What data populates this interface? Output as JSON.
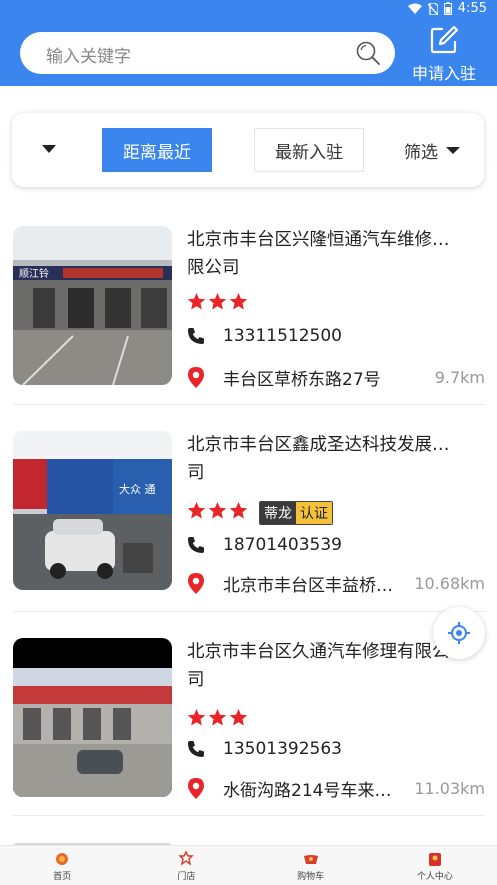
{
  "status_bar": {
    "time": "4:55"
  },
  "search": {
    "placeholder": "输入关键字"
  },
  "apply": {
    "label": "申请入驻"
  },
  "filters": {
    "nearest": "距离最近",
    "newest": "最新入驻",
    "filter": "筛选",
    "active": "nearest"
  },
  "shops": [
    {
      "name": "北京市丰台区兴隆恒通汽车维修…限公司",
      "name_line1": "北京市丰台区兴隆恒通汽车维修…",
      "name_line2": "限公司",
      "rating": 3,
      "phone": "13311512500",
      "address": "丰台区草桥东路27号",
      "distance": "9.7km",
      "sign_text": "顺江铃"
    },
    {
      "name_line1": "北京市丰台区鑫成圣达科技发展…",
      "name_line2": "司",
      "rating": 3,
      "badge_brand": "蒂龙",
      "badge_cert": "认证",
      "phone": "18701403539",
      "address": "北京市丰台区丰益桥…",
      "distance": "10.68km",
      "sign_text": "大众 通"
    },
    {
      "name_line1": "北京市丰台区久通汽车修理有限公",
      "name_line2": "司",
      "rating": 3,
      "phone": "13501392563",
      "address": "水衙沟路214号车来…",
      "distance": "11.03km"
    }
  ],
  "tabbar": [
    {
      "label": "首页",
      "icon": "home-icon"
    },
    {
      "label": "门店",
      "icon": "store-icon"
    },
    {
      "label": "购物车",
      "icon": "cart-icon"
    },
    {
      "label": "个人中心",
      "icon": "profile-icon"
    }
  ],
  "colors": {
    "primary": "#3a85ee",
    "star": "#e8262a",
    "pin": "#e8262a",
    "badge_cert": "#f5c03a"
  }
}
